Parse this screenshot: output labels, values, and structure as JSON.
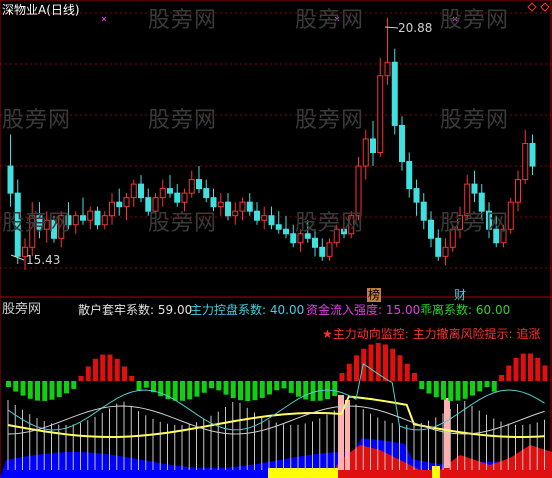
{
  "header": {
    "title": "深物业A(日线)",
    "high_label": "20.88",
    "low_label": "15.43",
    "tag_bang": "榜",
    "tag_cai": "财"
  },
  "watermark": "股旁网",
  "indicator": {
    "title": "股旁网",
    "items": [
      {
        "label": "散户套牢系数: 59.00",
        "color": "#e0e0e0"
      },
      {
        "label": "主力控盘系数: 40.00",
        "color": "#40d0e0"
      },
      {
        "label": "资金流入强度: 15.00",
        "color": "#e040e0"
      },
      {
        "label": "乖离系数: 60.00",
        "color": "#30d030"
      }
    ],
    "alert": "★主力动向监控: 主力撤离风险提示: 追涨"
  },
  "colors": {
    "up": "#ff3030",
    "down": "#40e0e0",
    "grid": "#8b0000",
    "red_bar": "#e01010",
    "green_bar": "#10d010",
    "blue_area": "#0000ff",
    "yellow_line": "#ffff60",
    "cyan_line": "#50d0d0",
    "white_line": "#d0d0d0"
  },
  "chart_data": {
    "type": "candlestick",
    "price_high": 20.88,
    "price_low": 15.43,
    "candles": [
      [
        17.6,
        18.3,
        16.7,
        17.0
      ],
      [
        17.0,
        17.3,
        15.43,
        15.6
      ],
      [
        15.6,
        16.0,
        15.3,
        15.8
      ],
      [
        15.8,
        16.8,
        15.6,
        16.5
      ],
      [
        16.5,
        16.8,
        16.0,
        16.2
      ],
      [
        16.2,
        16.6,
        15.9,
        16.4
      ],
      [
        16.4,
        16.5,
        15.9,
        16.0
      ],
      [
        16.0,
        16.6,
        15.8,
        16.5
      ],
      [
        16.5,
        16.8,
        16.2,
        16.3
      ],
      [
        16.3,
        16.6,
        16.1,
        16.5
      ],
      [
        16.5,
        16.9,
        16.3,
        16.4
      ],
      [
        16.4,
        16.7,
        16.2,
        16.6
      ],
      [
        16.6,
        16.7,
        16.2,
        16.3
      ],
      [
        16.3,
        16.6,
        16.2,
        16.5
      ],
      [
        16.5,
        17.0,
        16.3,
        16.8
      ],
      [
        16.8,
        17.1,
        16.5,
        16.7
      ],
      [
        16.7,
        17.0,
        16.4,
        16.9
      ],
      [
        16.9,
        17.3,
        16.7,
        17.2
      ],
      [
        17.2,
        17.4,
        16.8,
        16.9
      ],
      [
        16.9,
        17.1,
        16.5,
        16.6
      ],
      [
        16.6,
        17.0,
        16.5,
        16.9
      ],
      [
        16.9,
        17.3,
        16.7,
        17.1
      ],
      [
        17.1,
        17.4,
        16.9,
        17.0
      ],
      [
        17.0,
        17.2,
        16.7,
        16.8
      ],
      [
        16.8,
        17.1,
        16.6,
        17.0
      ],
      [
        17.0,
        17.5,
        16.9,
        17.3
      ],
      [
        17.3,
        17.6,
        17.0,
        17.1
      ],
      [
        17.1,
        17.3,
        16.8,
        16.9
      ],
      [
        16.9,
        17.1,
        16.6,
        16.7
      ],
      [
        16.7,
        17.0,
        16.5,
        16.8
      ],
      [
        16.8,
        17.0,
        16.4,
        16.5
      ],
      [
        16.5,
        16.8,
        16.3,
        16.6
      ],
      [
        16.6,
        16.9,
        16.4,
        16.8
      ],
      [
        16.8,
        17.0,
        16.5,
        16.6
      ],
      [
        16.6,
        16.8,
        16.3,
        16.4
      ],
      [
        16.4,
        16.7,
        16.2,
        16.5
      ],
      [
        16.5,
        16.7,
        16.2,
        16.3
      ],
      [
        16.3,
        16.6,
        16.1,
        16.2
      ],
      [
        16.2,
        16.5,
        16.0,
        16.1
      ],
      [
        16.1,
        16.3,
        15.8,
        15.9
      ],
      [
        15.9,
        16.2,
        15.7,
        16.1
      ],
      [
        16.1,
        16.4,
        15.9,
        16.0
      ],
      [
        16.0,
        16.2,
        15.6,
        15.8
      ],
      [
        15.8,
        16.0,
        15.5,
        15.6
      ],
      [
        15.6,
        16.0,
        15.5,
        15.9
      ],
      [
        15.9,
        16.3,
        15.8,
        16.2
      ],
      [
        16.2,
        16.5,
        16.0,
        16.1
      ],
      [
        16.1,
        16.6,
        16.0,
        16.5
      ],
      [
        16.5,
        17.8,
        16.4,
        17.6
      ],
      [
        17.6,
        18.4,
        17.3,
        18.2
      ],
      [
        18.2,
        18.6,
        17.6,
        17.9
      ],
      [
        17.9,
        20.0,
        17.8,
        19.6
      ],
      [
        19.6,
        20.88,
        19.4,
        19.9
      ],
      [
        19.9,
        20.2,
        18.3,
        18.5
      ],
      [
        18.5,
        18.7,
        17.5,
        17.7
      ],
      [
        17.7,
        17.9,
        16.9,
        17.1
      ],
      [
        17.1,
        17.3,
        16.5,
        16.8
      ],
      [
        16.8,
        17.0,
        16.2,
        16.4
      ],
      [
        16.4,
        16.6,
        15.8,
        16.0
      ],
      [
        16.0,
        16.2,
        15.5,
        15.6
      ],
      [
        15.6,
        16.0,
        15.4,
        15.8
      ],
      [
        15.8,
        16.3,
        15.7,
        16.2
      ],
      [
        16.2,
        16.7,
        16.0,
        16.5
      ],
      [
        16.5,
        17.4,
        16.4,
        17.2
      ],
      [
        17.2,
        17.5,
        16.8,
        17.0
      ],
      [
        17.0,
        17.2,
        16.4,
        16.6
      ],
      [
        16.6,
        16.8,
        16.0,
        16.2
      ],
      [
        16.2,
        16.5,
        15.8,
        15.9
      ],
      [
        15.9,
        16.3,
        15.8,
        16.2
      ],
      [
        16.2,
        16.9,
        16.1,
        16.8
      ],
      [
        16.8,
        17.5,
        16.6,
        17.3
      ],
      [
        17.3,
        18.4,
        17.2,
        18.1
      ],
      [
        18.1,
        18.3,
        17.4,
        17.6
      ]
    ]
  }
}
